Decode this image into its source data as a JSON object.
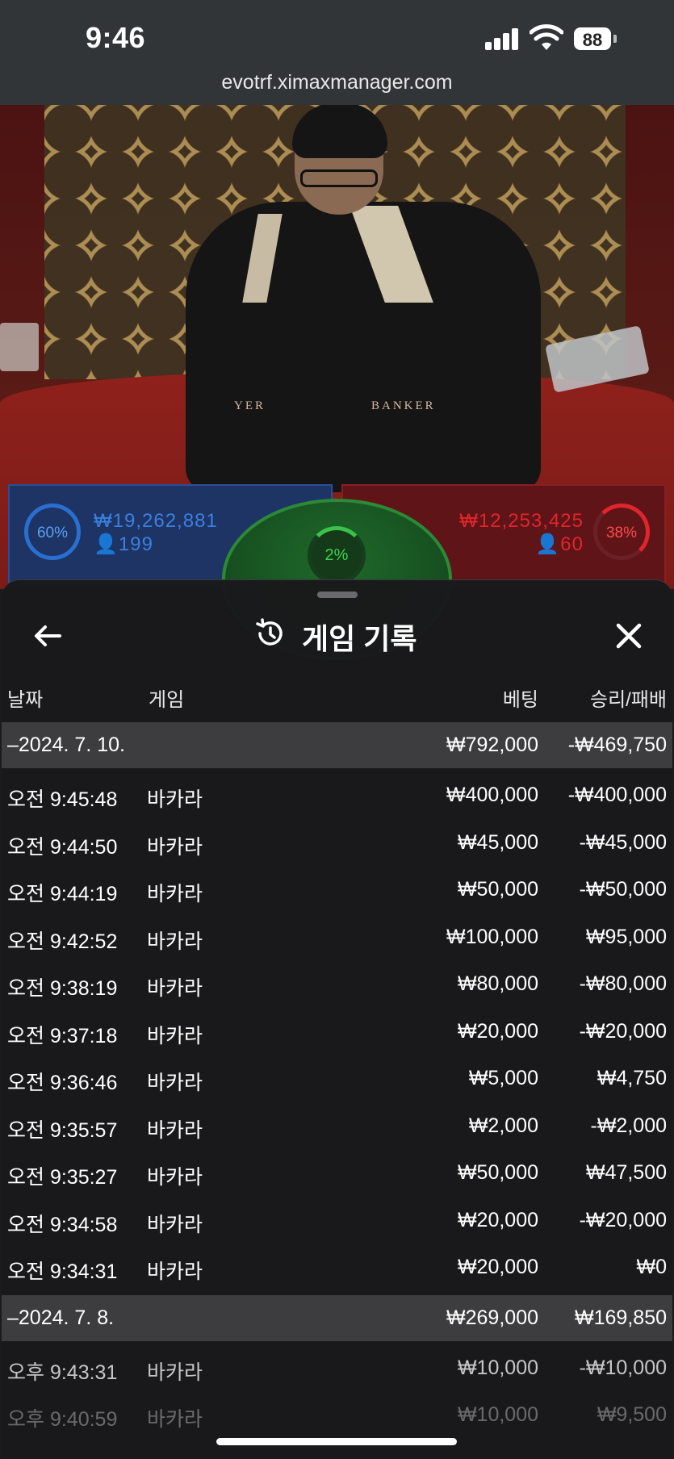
{
  "status_bar": {
    "time": "9:46",
    "battery": "88",
    "url": "evotrf.ximaxmanager.com"
  },
  "video": {
    "table_label_player": "YER",
    "table_label_banker": "BANKER"
  },
  "bet_bars": {
    "player": {
      "percent": "60%",
      "amount": "₩19,262,881",
      "players": "199",
      "color": "#2a6fd0"
    },
    "tie": {
      "percent": "2%",
      "color": "#3ac24a"
    },
    "banker": {
      "percent": "38%",
      "amount": "₩12,253,425",
      "players": "60",
      "color": "#e0262c"
    }
  },
  "panel": {
    "title": "게임 기록",
    "columns": {
      "date": "날짜",
      "game": "게임",
      "bet": "베팅",
      "result": "승리/패배"
    },
    "groups": [
      {
        "date": "–2024. 7. 10.",
        "bet": "₩792,000",
        "result": "-₩469,750",
        "rows": [
          {
            "time": "오전 9:45:48",
            "game": "바카라",
            "bet": "₩400,000",
            "result": "-₩400,000"
          },
          {
            "time": "오전 9:44:50",
            "game": "바카라",
            "bet": "₩45,000",
            "result": "-₩45,000"
          },
          {
            "time": "오전 9:44:19",
            "game": "바카라",
            "bet": "₩50,000",
            "result": "-₩50,000"
          },
          {
            "time": "오전 9:42:52",
            "game": "바카라",
            "bet": "₩100,000",
            "result": "₩95,000"
          },
          {
            "time": "오전 9:38:19",
            "game": "바카라",
            "bet": "₩80,000",
            "result": "-₩80,000"
          },
          {
            "time": "오전 9:37:18",
            "game": "바카라",
            "bet": "₩20,000",
            "result": "-₩20,000"
          },
          {
            "time": "오전 9:36:46",
            "game": "바카라",
            "bet": "₩5,000",
            "result": "₩4,750"
          },
          {
            "time": "오전 9:35:57",
            "game": "바카라",
            "bet": "₩2,000",
            "result": "-₩2,000"
          },
          {
            "time": "오전 9:35:27",
            "game": "바카라",
            "bet": "₩50,000",
            "result": "₩47,500"
          },
          {
            "time": "오전 9:34:58",
            "game": "바카라",
            "bet": "₩20,000",
            "result": "-₩20,000"
          },
          {
            "time": "오전 9:34:31",
            "game": "바카라",
            "bet": "₩20,000",
            "result": "₩0"
          }
        ]
      },
      {
        "date": "–2024. 7. 8.",
        "bet": "₩269,000",
        "result": "₩169,850",
        "rows": [
          {
            "time": "오후 9:43:31",
            "game": "바카라",
            "bet": "₩10,000",
            "result": "-₩10,000"
          },
          {
            "time": "오후 9:40:59",
            "game": "바카라",
            "bet": "₩10,000",
            "result": "₩9,500"
          }
        ]
      }
    ]
  }
}
